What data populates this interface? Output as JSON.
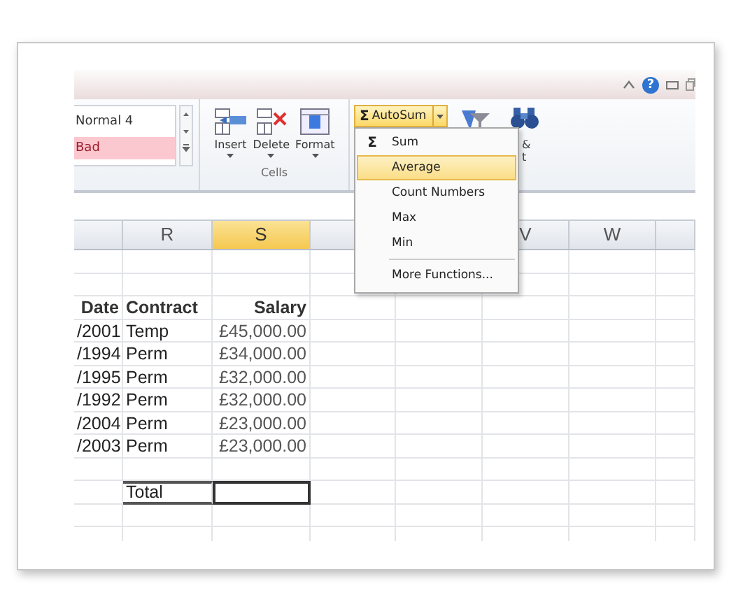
{
  "title_bar": {
    "help": "?"
  },
  "ribbon": {
    "styles": [
      {
        "label": "Normal 4",
        "kind": "normal"
      },
      {
        "label": "Bad",
        "kind": "bad"
      }
    ],
    "cells": {
      "buttons": [
        {
          "label": "Insert",
          "kind": "insert"
        },
        {
          "label": "Delete",
          "kind": "delete"
        },
        {
          "label": "Format",
          "kind": "format"
        }
      ],
      "group_label": "Cells"
    },
    "editing": {
      "autosum": {
        "symbol": "Σ",
        "label": "AutoSum"
      },
      "cut_labels": [
        "&",
        "t"
      ]
    }
  },
  "autosum_menu": [
    [
      {
        "label": "Sum",
        "symbol": "Σ",
        "selected": false
      },
      {
        "label": "Average",
        "selected": true
      },
      {
        "label": "Count Numbers",
        "selected": false
      },
      {
        "label": "Max",
        "selected": false
      },
      {
        "label": "Min",
        "selected": false
      }
    ],
    [
      {
        "label": "More Functions...",
        "selected": false
      }
    ]
  ],
  "columns": [
    {
      "label": "R",
      "selected": false
    },
    {
      "label": "S",
      "selected": true
    },
    {
      "label": "V",
      "selected": false
    },
    {
      "label": "W",
      "selected": false
    }
  ],
  "table": {
    "header": [
      "Date",
      "Contract",
      "Salary"
    ],
    "rows": [
      [
        "/2001",
        "Temp",
        "£45,000.00"
      ],
      [
        "/1994",
        "Perm",
        "£34,000.00"
      ],
      [
        "/1995",
        "Perm",
        "£32,000.00"
      ],
      [
        "/1992",
        "Perm",
        "£32,000.00"
      ],
      [
        "/2004",
        "Perm",
        "£23,000.00"
      ],
      [
        "/2003",
        "Perm",
        "£23,000.00"
      ]
    ],
    "total": {
      "label": "Total",
      "value_selected": true
    }
  }
}
